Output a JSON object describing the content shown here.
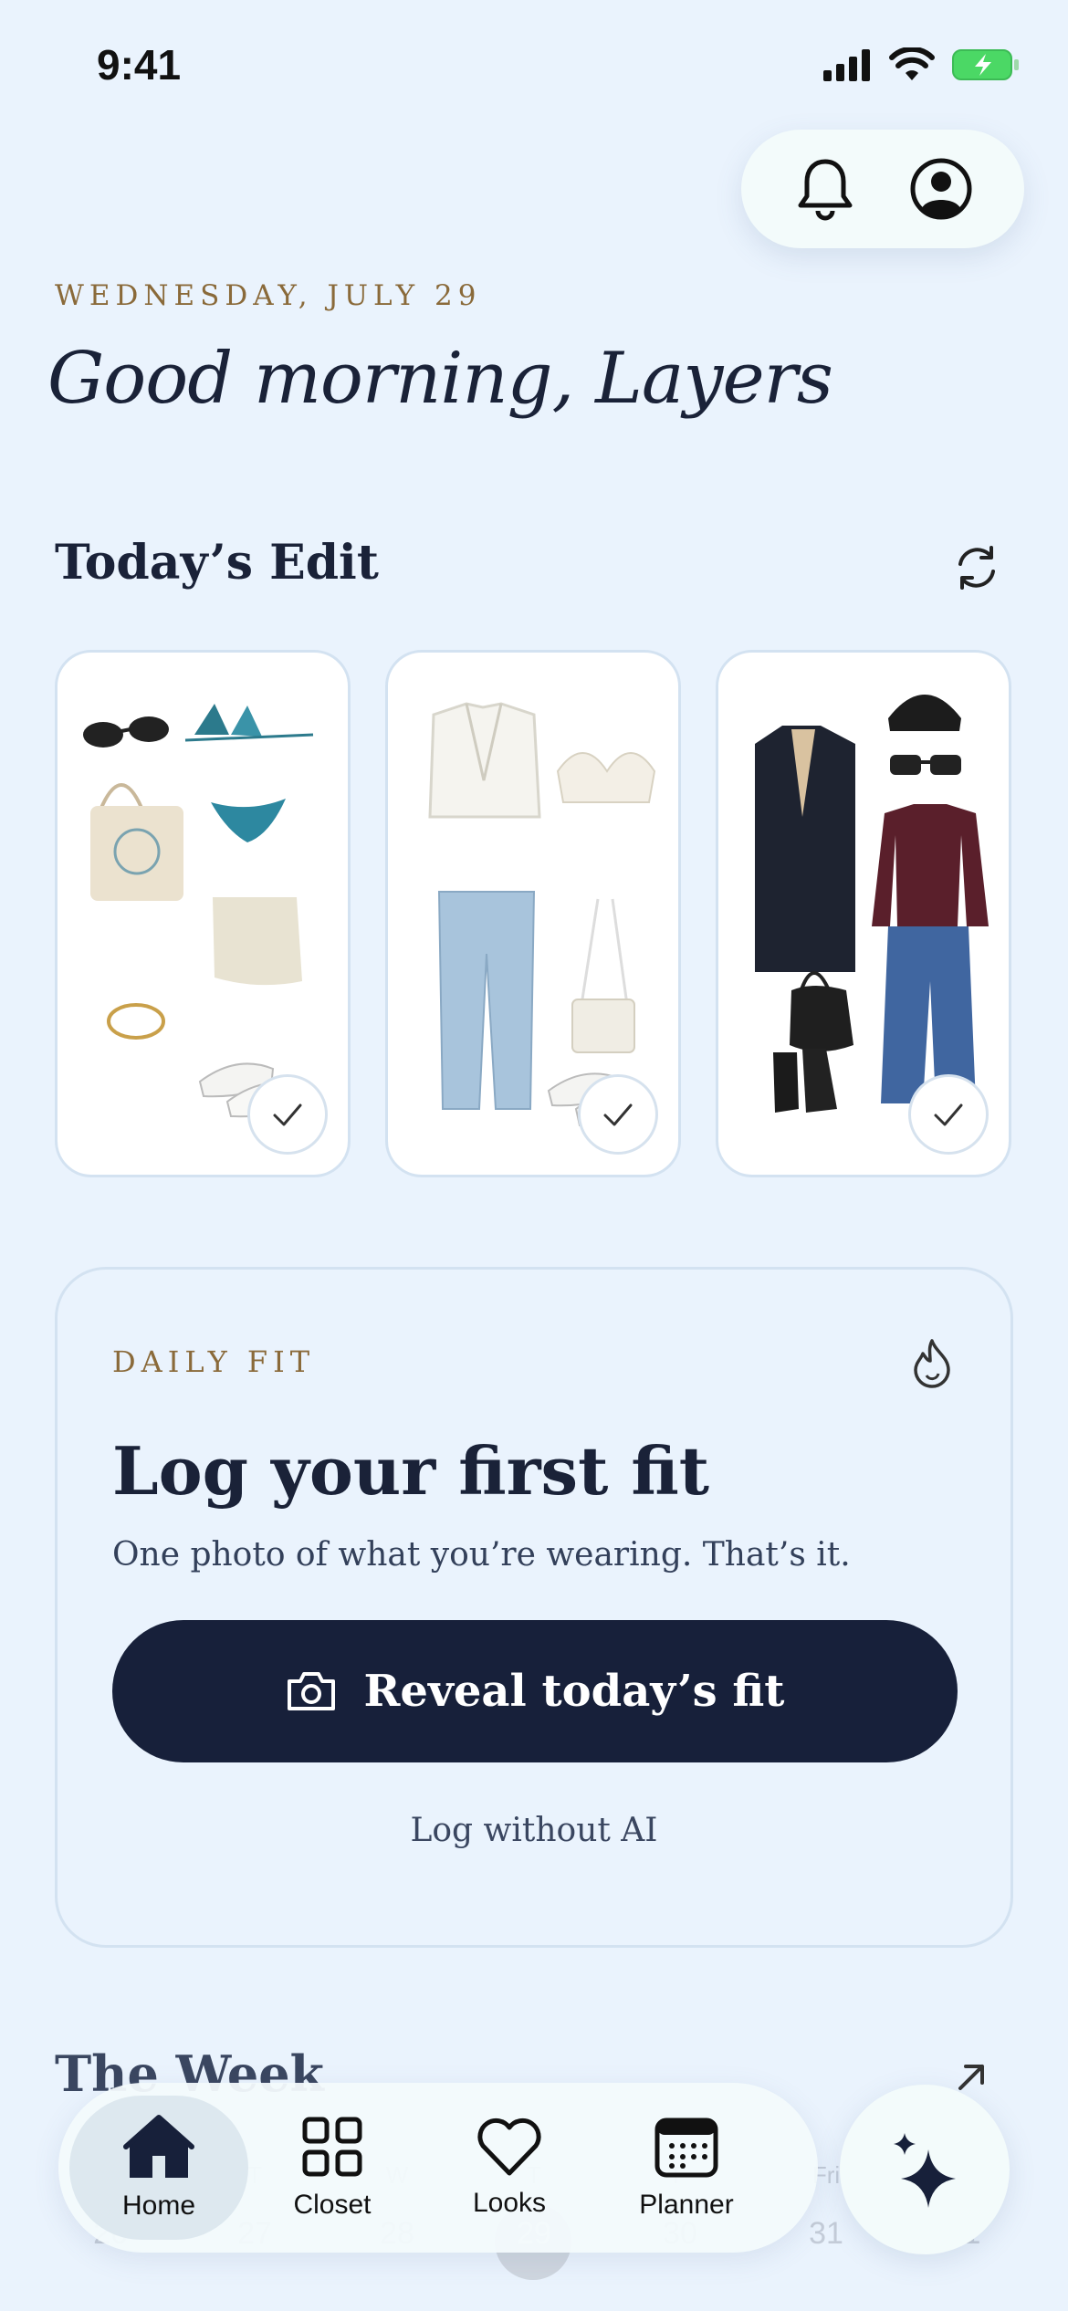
{
  "status_bar": {
    "time": "9:41"
  },
  "header": {
    "date": "WEDNESDAY, JULY 29",
    "greeting": "Good morning, Layers"
  },
  "todays_edit": {
    "title": "Today’s Edit",
    "outfits": [
      {
        "items": [
          "sunglasses",
          "blue bikini top",
          "blue bikini bottom",
          "canvas tote bag",
          "wrap skirt",
          "gold anklet",
          "white slide sandals"
        ]
      },
      {
        "items": [
          "white blazer",
          "white lace bralette",
          "light wash jeans",
          "white shoulder bag",
          "white slide sandals"
        ]
      },
      {
        "items": [
          "black beanie",
          "black sunglasses",
          "black coat with scarf",
          "burgundy sweater",
          "black quilted bag",
          "blue flare jeans",
          "black ankle boots"
        ]
      }
    ]
  },
  "daily_fit": {
    "label": "DAILY FIT",
    "title": "Log your first fit",
    "subtitle": "One photo of what you’re wearing. That’s it.",
    "cta": "Reveal today’s fit",
    "secondary": "Log without AI"
  },
  "week": {
    "title": "The Week",
    "days": [
      {
        "dow": "M",
        "num": "26"
      },
      {
        "dow": "T",
        "num": "27"
      },
      {
        "dow": "W",
        "num": "28"
      },
      {
        "dow": "T",
        "num": "29"
      },
      {
        "dow": "F",
        "num": "30"
      },
      {
        "dow": "Fri",
        "num": "31"
      },
      {
        "dow": "S",
        "num": "1"
      }
    ]
  },
  "tab_bar": {
    "tabs": [
      {
        "label": "Home",
        "icon": "home-icon",
        "active": true
      },
      {
        "label": "Closet",
        "icon": "grid-icon"
      },
      {
        "label": "Looks",
        "icon": "heart-icon"
      },
      {
        "label": "Planner",
        "icon": "calendar-icon"
      }
    ]
  },
  "colors": {
    "background": "#eaf3fd",
    "navy": "#17203a",
    "accent_gold": "#8a6a3a"
  }
}
